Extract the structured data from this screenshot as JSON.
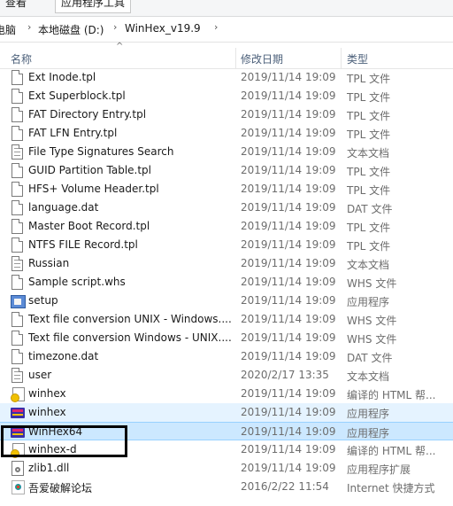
{
  "ribbon": {
    "tabs": [
      "查看",
      "应用程序工具"
    ]
  },
  "address": {
    "crumbs": [
      "电脑",
      "本地磁盘 (D:)",
      "WinHex_v19.9"
    ]
  },
  "columns": {
    "name": "名称",
    "modified": "修改日期",
    "type": "类型"
  },
  "rows": [
    {
      "name": "Ext Inode.tpl",
      "date": "2019/11/14 19:09",
      "type": "TPL 文件",
      "icon": "file-icon"
    },
    {
      "name": "Ext Superblock.tpl",
      "date": "2019/11/14 19:09",
      "type": "TPL 文件",
      "icon": "file-icon"
    },
    {
      "name": "FAT Directory Entry.tpl",
      "date": "2019/11/14 19:09",
      "type": "TPL 文件",
      "icon": "file-icon"
    },
    {
      "name": "FAT LFN Entry.tpl",
      "date": "2019/11/14 19:09",
      "type": "TPL 文件",
      "icon": "file-icon"
    },
    {
      "name": "File Type Signatures Search",
      "date": "2019/11/14 19:09",
      "type": "文本文档",
      "icon": "text-file-icon"
    },
    {
      "name": "GUID Partition Table.tpl",
      "date": "2019/11/14 19:09",
      "type": "TPL 文件",
      "icon": "file-icon"
    },
    {
      "name": "HFS+ Volume Header.tpl",
      "date": "2019/11/14 19:09",
      "type": "TPL 文件",
      "icon": "file-icon"
    },
    {
      "name": "language.dat",
      "date": "2019/11/14 19:09",
      "type": "DAT 文件",
      "icon": "file-icon"
    },
    {
      "name": "Master Boot Record.tpl",
      "date": "2019/11/14 19:09",
      "type": "TPL 文件",
      "icon": "file-icon"
    },
    {
      "name": "NTFS FILE Record.tpl",
      "date": "2019/11/14 19:09",
      "type": "TPL 文件",
      "icon": "file-icon"
    },
    {
      "name": "Russian",
      "date": "2019/11/14 19:09",
      "type": "文本文档",
      "icon": "text-file-icon"
    },
    {
      "name": "Sample script.whs",
      "date": "2019/11/14 19:09",
      "type": "WHS 文件",
      "icon": "file-icon"
    },
    {
      "name": "setup",
      "date": "2019/11/14 19:09",
      "type": "应用程序",
      "icon": "setup-icon"
    },
    {
      "name": "Text file conversion UNIX - Windows....",
      "date": "2019/11/14 19:09",
      "type": "WHS 文件",
      "icon": "file-icon"
    },
    {
      "name": "Text file conversion Windows - UNIX....",
      "date": "2019/11/14 19:09",
      "type": "WHS 文件",
      "icon": "file-icon"
    },
    {
      "name": "timezone.dat",
      "date": "2019/11/14 19:09",
      "type": "DAT 文件",
      "icon": "file-icon"
    },
    {
      "name": "user",
      "date": "2020/2/17 13:35",
      "type": "文本文档",
      "icon": "text-file-icon"
    },
    {
      "name": "winhex",
      "date": "2019/11/14 19:09",
      "type": "编译的 HTML 帮...",
      "icon": "help-file-icon"
    },
    {
      "name": "winhex",
      "date": "2019/11/14 19:09",
      "type": "应用程序",
      "icon": "winhex-app-icon"
    },
    {
      "name": "WinHex64",
      "date": "2019/11/14 19:09",
      "type": "应用程序",
      "icon": "winhex-app-icon"
    },
    {
      "name": "winhex-d",
      "date": "2019/11/14 19:09",
      "type": "编译的 HTML 帮...",
      "icon": "help-file-icon"
    },
    {
      "name": "zlib1.dll",
      "date": "2019/11/14 19:09",
      "type": "应用程序扩展",
      "icon": "dll-icon"
    },
    {
      "name": "吾爱破解论坛",
      "date": "2016/2/22 11:54",
      "type": "Internet 快捷方式",
      "icon": "shortcut-icon"
    }
  ],
  "state": {
    "hovered_row": 18,
    "selected_row": 19
  }
}
